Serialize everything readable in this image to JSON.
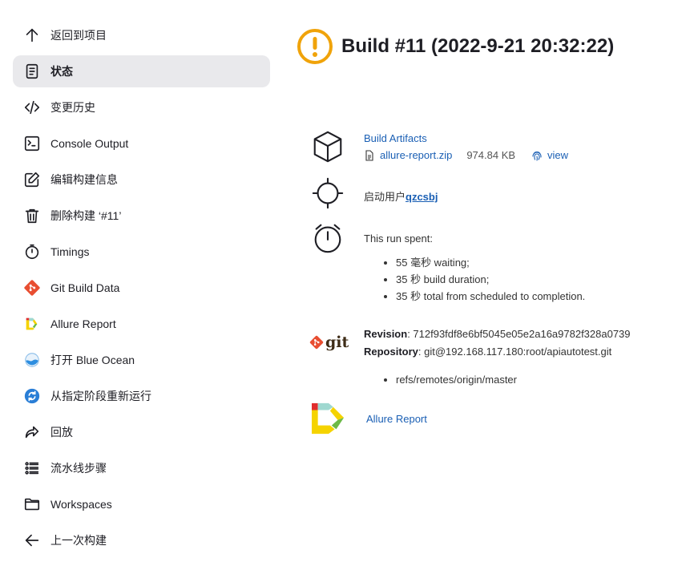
{
  "sidebar": {
    "items": [
      {
        "label": "返回到项目",
        "icon": "arrow-up-icon"
      },
      {
        "label": "状态",
        "icon": "document-icon",
        "active": true
      },
      {
        "label": "变更历史",
        "icon": "code-icon"
      },
      {
        "label": "Console Output",
        "icon": "terminal-icon"
      },
      {
        "label": "编辑构建信息",
        "icon": "edit-icon"
      },
      {
        "label": "删除构建 ‘#11’",
        "icon": "trash-icon"
      },
      {
        "label": "Timings",
        "icon": "stopwatch-icon"
      },
      {
        "label": "Git Build Data",
        "icon": "git-icon"
      },
      {
        "label": "Allure Report",
        "icon": "allure-icon"
      },
      {
        "label": "打开 Blue Ocean",
        "icon": "blue-ocean-icon"
      },
      {
        "label": "从指定阶段重新运行",
        "icon": "restart-icon"
      },
      {
        "label": "回放",
        "icon": "replay-icon"
      },
      {
        "label": "流水线步骤",
        "icon": "steps-icon"
      },
      {
        "label": "Workspaces",
        "icon": "folder-icon"
      },
      {
        "label": "上一次构建",
        "icon": "arrow-left-icon"
      }
    ]
  },
  "header": {
    "title": "Build #11 (2022-9-21 20:32:22)",
    "status_color": "#f0a30a"
  },
  "artifacts": {
    "heading": "Build Artifacts",
    "file_name": "allure-report.zip",
    "file_size": "974.84 KB",
    "view_label": "view"
  },
  "started_by": {
    "prefix": "启动用户",
    "user": "qzcsbj"
  },
  "timing": {
    "heading": "This run spent:",
    "items": [
      "55 毫秒 waiting;",
      "35 秒 build duration;",
      "35 秒 total from scheduled to completion."
    ]
  },
  "git": {
    "revision_label": "Revision",
    "revision_value": ": 712f93fdf8e6bf5045e05e2a16a9782f328a0739",
    "repository_label": "Repository",
    "repository_value": ": git@192.168.117.180:root/apiautotest.git",
    "branches": [
      "refs/remotes/origin/master"
    ],
    "logo_text": "git"
  },
  "allure": {
    "label": "Allure Report"
  },
  "colors": {
    "accent": "#1a5fb4",
    "active_bg": "#e9e9ec",
    "git_orange": "#e84e31",
    "warning": "#f0a30a"
  }
}
